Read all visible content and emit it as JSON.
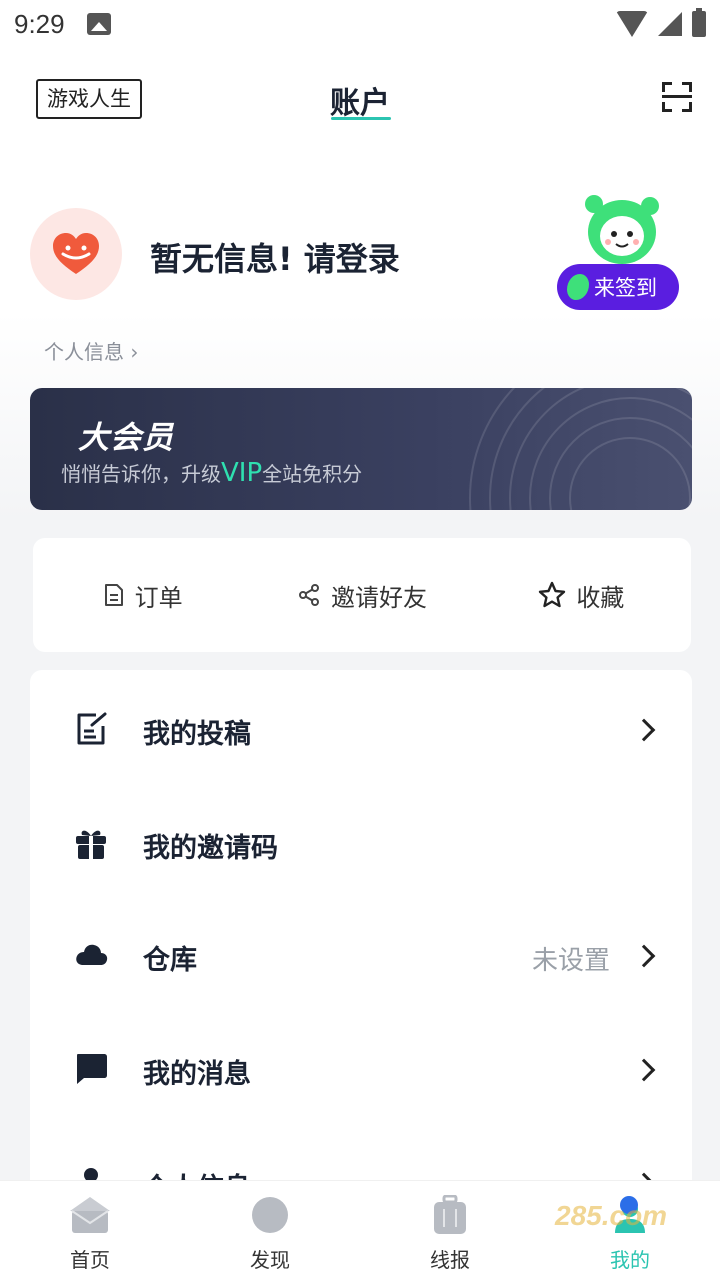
{
  "status_bar": {
    "time": "9:29"
  },
  "header": {
    "app_tag": "游戏人生",
    "title": "账户"
  },
  "profile": {
    "login_prompt": "暂无信息! 请登录",
    "info_link": "个人信息 ›",
    "signin_button": "来签到"
  },
  "vip": {
    "title": "大会员",
    "subtitle_prefix": "悄悄告诉你，升级",
    "subtitle_vip": "VIP",
    "subtitle_suffix": "全站免积分"
  },
  "quick_actions": [
    {
      "label": "订单",
      "icon": "document-icon"
    },
    {
      "label": "邀请好友",
      "icon": "share-icon"
    },
    {
      "label": "收藏",
      "icon": "star-icon"
    }
  ],
  "menu": [
    {
      "label": "我的投稿",
      "icon": "edit-note-icon",
      "value": ""
    },
    {
      "label": "我的邀请码",
      "icon": "gift-icon",
      "value": ""
    },
    {
      "label": "仓库",
      "icon": "cloud-icon",
      "value": "未设置"
    },
    {
      "label": "我的消息",
      "icon": "message-icon",
      "value": ""
    },
    {
      "label": "个人信息",
      "icon": "person-icon",
      "value": ""
    }
  ],
  "bottom_nav": [
    {
      "label": "首页",
      "icon": "home-icon",
      "active": false
    },
    {
      "label": "发现",
      "icon": "discover-icon",
      "active": false
    },
    {
      "label": "线报",
      "icon": "luggage-icon",
      "active": false
    },
    {
      "label": "我的",
      "icon": "profile-icon",
      "active": true
    }
  ],
  "watermark": "285.com",
  "colors": {
    "accent": "#2bc4b1",
    "signin": "#5a1ee0",
    "vip_text": "#2fe0b0",
    "background": "#f3f4f6"
  }
}
